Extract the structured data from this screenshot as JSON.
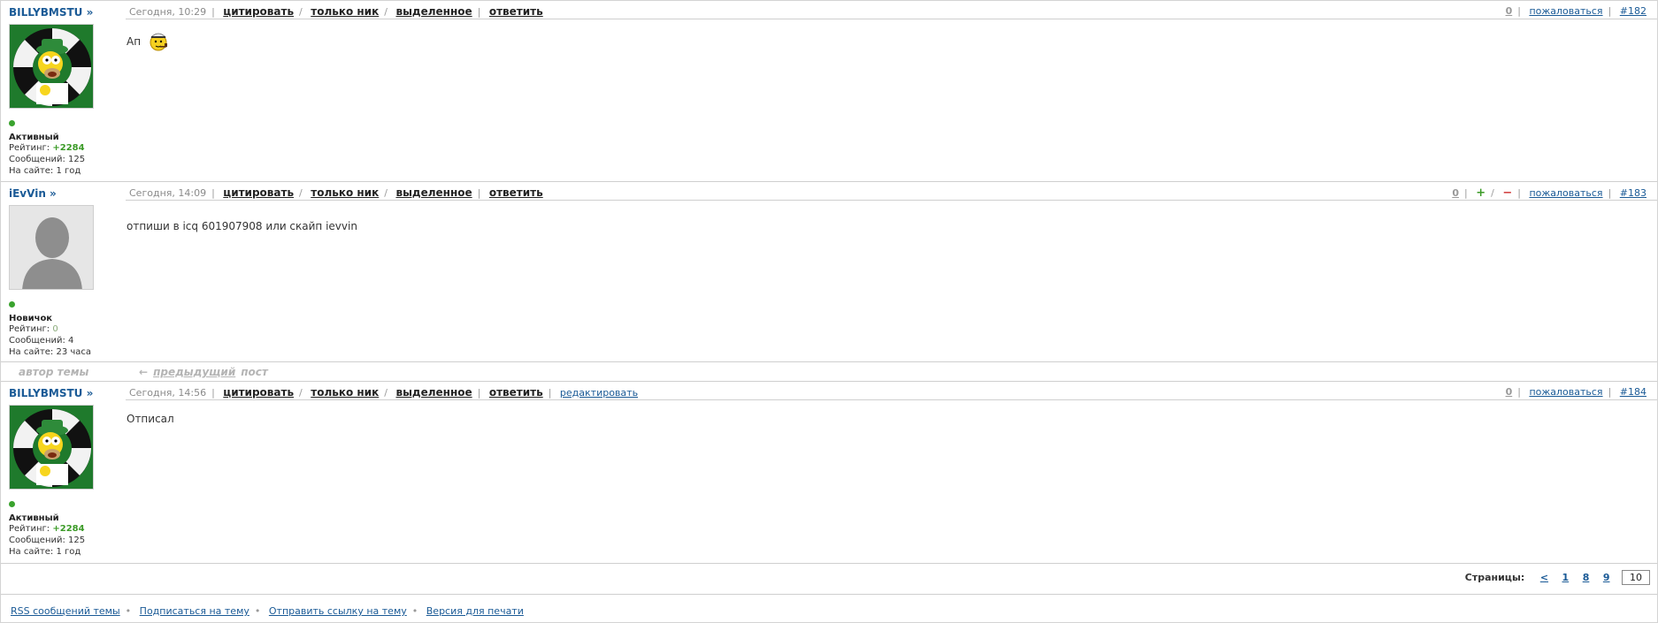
{
  "posts": [
    {
      "nick": "BILLYBMSTU »",
      "date": "Сегодня, 10:29",
      "actions": [
        "цитировать",
        "только ник",
        "выделенное",
        "ответить"
      ],
      "status": "Активный",
      "rating_label": "Рейтинг:",
      "rating": "+2284",
      "messages": "Сообщений: 125",
      "onsite": "На сайте: 1 год",
      "votes": "0",
      "complain": "пожаловаться",
      "num": "#182",
      "text": "Ап",
      "smiley": "pipe-smoking-smiley-icon"
    },
    {
      "nick": "iEvVin »",
      "date": "Сегодня, 14:09",
      "actions": [
        "цитировать",
        "только ник",
        "выделенное",
        "ответить"
      ],
      "status": "Новичок",
      "rating_label": "Рейтинг:",
      "rating": "0",
      "messages": "Сообщений: 4",
      "onsite": "На сайте: 23 часа",
      "votes": "0",
      "plus": "+",
      "minus": "−",
      "complain": "пожаловаться",
      "num": "#183",
      "text": "отпиши в icq 601907908 или скайп ievvin"
    },
    {
      "nick": "BILLYBMSTU »",
      "date": "Сегодня, 14:56",
      "actions": [
        "цитировать",
        "только ник",
        "выделенное",
        "ответить"
      ],
      "edit": "редактировать",
      "status": "Активный",
      "rating_label": "Рейтинг:",
      "rating": "+2284",
      "messages": "Сообщений: 125",
      "onsite": "На сайте: 1 год",
      "votes": "0",
      "complain": "пожаловаться",
      "num": "#184",
      "text": "Отписал"
    }
  ],
  "between": {
    "author": "автор темы",
    "arrow": "←",
    "prev": "предыдущий",
    "post": "пост"
  },
  "pager": {
    "label": "Страницы:",
    "prev": "<",
    "pages": [
      "1",
      "8",
      "9"
    ],
    "current": "10"
  },
  "footer": [
    "RSS сообщений темы",
    "Подписаться на тему",
    "Отправить ссылку на тему",
    "Версия для печати"
  ],
  "colors": {
    "link": "#1a5a96",
    "rating_positive": "#3c9b28",
    "online": "#3aa32e"
  }
}
